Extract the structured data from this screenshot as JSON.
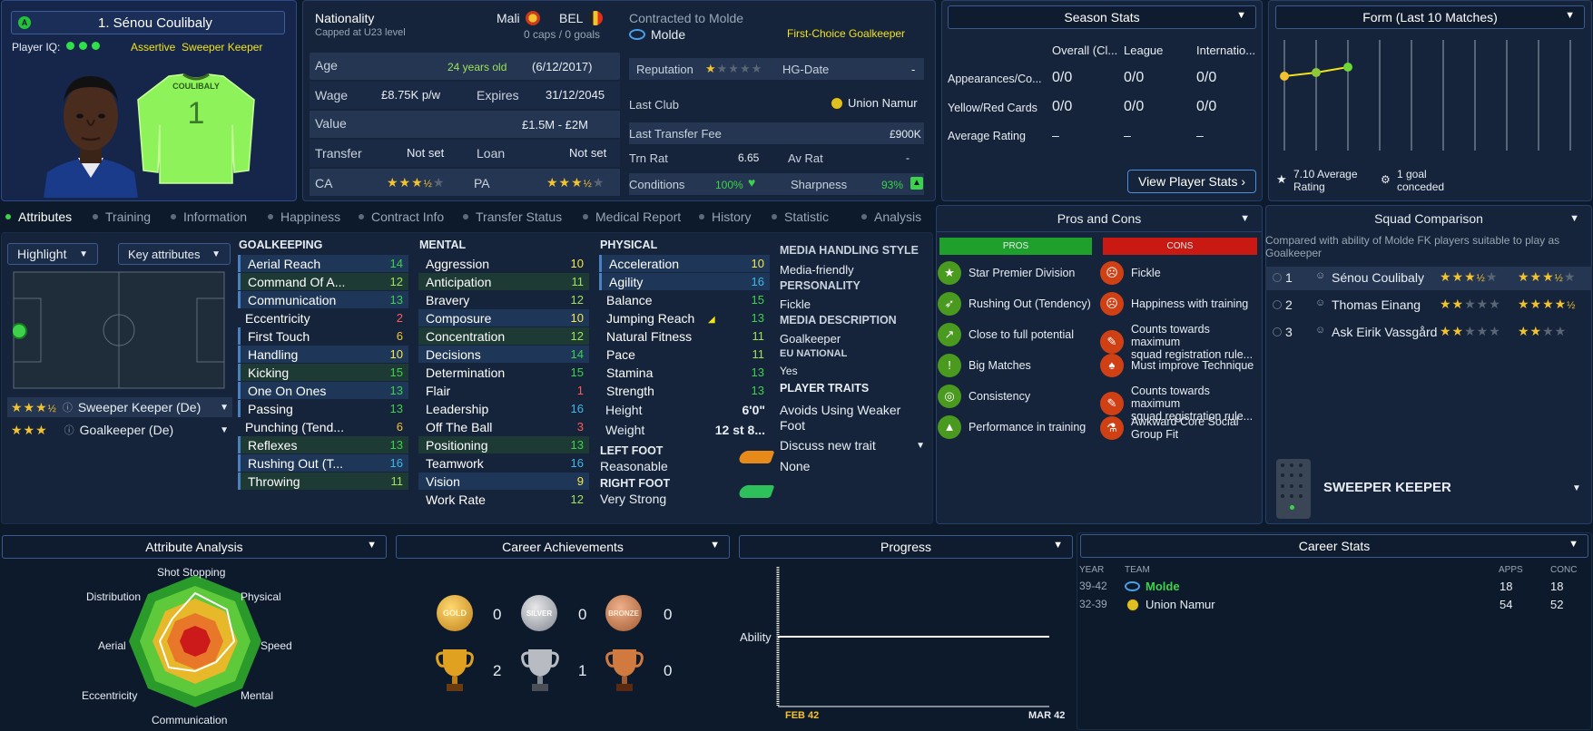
{
  "player": {
    "name": "1. Sénou Coulibaly",
    "iq_label": "Player IQ:",
    "role_prefix": "Assertive",
    "role_name": "Sweeper Keeper",
    "shirt_name": "COULIBALY",
    "shirt_number": "1"
  },
  "bio": {
    "nationality_label": "Nationality",
    "nationality_sub": "Capped at U23 level",
    "nation1": "Mali",
    "nation2": "BEL",
    "caps": "0 caps / 0 goals",
    "age_label": "Age",
    "age": "24 years old",
    "dob": "(6/12/2017)",
    "wage_label": "Wage",
    "wage": "£8.75K p/w",
    "expires_label": "Expires",
    "expires": "31/12/2045",
    "value_label": "Value",
    "value": "£1.5M - £2M",
    "transfer_label": "Transfer",
    "transfer": "Not set",
    "loan_label": "Loan",
    "loan": "Not set",
    "ca_label": "CA",
    "pa_label": "PA",
    "ca_stars": "★★★",
    "ca_half": "½",
    "ca_grey": "★",
    "pa_stars": "★★★",
    "pa_half": "½",
    "pa_grey": "★"
  },
  "contract": {
    "contracted_label": "Contracted to Molde",
    "club": "Molde",
    "status": "First-Choice Goalkeeper",
    "reputation_label": "Reputation",
    "rep_stars": "★",
    "rep_grey": "★★★★",
    "hg_label": "HG-Date",
    "hg_value": "-",
    "last_club_label": "Last Club",
    "last_club": "Union Namur",
    "last_fee_label": "Last Transfer Fee",
    "last_fee": "£900K",
    "trn_label": "Trn Rat",
    "trn_value": "6.65",
    "av_label": "Av Rat",
    "av_value": "-",
    "conditions_label": "Conditions",
    "conditions_value": "100%",
    "sharpness_label": "Sharpness",
    "sharpness_value": "93%"
  },
  "season": {
    "title": "Season Stats",
    "cols": [
      "Overall (Cl...",
      "League",
      "Internatio..."
    ],
    "rows": [
      {
        "label": "Appearances/Co...",
        "v": [
          "0/0",
          "0/0",
          "0/0"
        ]
      },
      {
        "label": "Yellow/Red Cards",
        "v": [
          "0/0",
          "0/0",
          "0/0"
        ]
      },
      {
        "label": "Average Rating",
        "v": [
          "–",
          "–",
          "–"
        ]
      }
    ],
    "button": "View Player Stats"
  },
  "form": {
    "title": "Form (Last 10 Matches)",
    "avg_value": "7.10",
    "avg_label": "Average",
    "avg_label2": "Rating",
    "goal_label": "1 goal",
    "goal_label2": "conceded"
  },
  "tabs": [
    "Attributes",
    "Training",
    "Information",
    "Happiness",
    "Contract Info",
    "Transfer Status",
    "Medical Report",
    "History",
    "Statistic",
    "Analysis"
  ],
  "controls": {
    "highlight": "Highlight",
    "key_attributes": "Key attributes"
  },
  "roles": [
    {
      "stars": "★★★",
      "half": "½",
      "name": "Sweeper Keeper (De)"
    },
    {
      "stars": "★★★",
      "half": "",
      "name": "Goalkeeper (De)"
    }
  ],
  "goalkeeping": {
    "title": "GOALKEEPING",
    "items": [
      {
        "n": "Aerial Reach",
        "v": "14"
      },
      {
        "n": "Command Of A...",
        "v": "12"
      },
      {
        "n": "Communication",
        "v": "13"
      },
      {
        "n": "Eccentricity",
        "v": "2"
      },
      {
        "n": "First Touch",
        "v": "6"
      },
      {
        "n": "Handling",
        "v": "10"
      },
      {
        "n": "Kicking",
        "v": "15"
      },
      {
        "n": "One On Ones",
        "v": "13"
      },
      {
        "n": "Passing",
        "v": "13"
      },
      {
        "n": "Punching (Tend...",
        "v": "6"
      },
      {
        "n": "Reflexes",
        "v": "13"
      },
      {
        "n": "Rushing Out (T...",
        "v": "16"
      },
      {
        "n": "Throwing",
        "v": "11"
      }
    ]
  },
  "mental": {
    "title": "MENTAL",
    "items": [
      {
        "n": "Aggression",
        "v": "10"
      },
      {
        "n": "Anticipation",
        "v": "11"
      },
      {
        "n": "Bravery",
        "v": "12"
      },
      {
        "n": "Composure",
        "v": "10"
      },
      {
        "n": "Concentration",
        "v": "12"
      },
      {
        "n": "Decisions",
        "v": "14"
      },
      {
        "n": "Determination",
        "v": "15"
      },
      {
        "n": "Flair",
        "v": "1"
      },
      {
        "n": "Leadership",
        "v": "16"
      },
      {
        "n": "Off The Ball",
        "v": "3"
      },
      {
        "n": "Positioning",
        "v": "13"
      },
      {
        "n": "Teamwork",
        "v": "16"
      },
      {
        "n": "Vision",
        "v": "9"
      },
      {
        "n": "Work Rate",
        "v": "12"
      }
    ]
  },
  "physical": {
    "title": "PHYSICAL",
    "items": [
      {
        "n": "Acceleration",
        "v": "10"
      },
      {
        "n": "Agility",
        "v": "16"
      },
      {
        "n": "Balance",
        "v": "15"
      },
      {
        "n": "Jumping Reach",
        "v": "13"
      },
      {
        "n": "Natural Fitness",
        "v": "11"
      },
      {
        "n": "Pace",
        "v": "11"
      },
      {
        "n": "Stamina",
        "v": "13"
      },
      {
        "n": "Strength",
        "v": "13"
      }
    ],
    "height_label": "Height",
    "height": "6'0\"",
    "weight_label": "Weight",
    "weight": "12 st 8...",
    "left_foot_label": "LEFT FOOT",
    "left_foot": "Reasonable",
    "right_foot_label": "RIGHT FOOT",
    "right_foot": "Very Strong"
  },
  "media": {
    "style_title": "MEDIA HANDLING STYLE",
    "style": "Media-friendly",
    "personality_title": "PERSONALITY",
    "personality": "Fickle",
    "desc_title": "MEDIA DESCRIPTION",
    "desc": "Goalkeeper",
    "eu_title": "EU NATIONAL",
    "eu": "Yes",
    "traits_title": "PLAYER TRAITS",
    "trait1": "Avoids Using Weaker",
    "trait1b": "Foot",
    "discuss": "Discuss new trait",
    "none": "None"
  },
  "proscons": {
    "title": "Pros and Cons",
    "pros_label": "PROS",
    "cons_label": "CONS",
    "pros": [
      "Star Premier Division",
      "Rushing Out (Tendency)",
      "Close to full potential",
      "Big Matches",
      "Consistency",
      "Performance in training"
    ],
    "cons": [
      {
        "a": "Fickle",
        "b": ""
      },
      {
        "a": "Happiness with training",
        "b": ""
      },
      {
        "a": "Counts towards maximum",
        "b": "squad registration rule..."
      },
      {
        "a": "Must improve Technique",
        "b": ""
      },
      {
        "a": "Counts towards maximum",
        "b": "squad registration rule..."
      },
      {
        "a": "Awkward Core Social",
        "b": "Group Fit"
      }
    ]
  },
  "squad": {
    "title": "Squad Comparison",
    "desc": "Compared with ability of Molde FK players suitable to play as Goalkeeper",
    "rows": [
      {
        "rank": "1",
        "name": "Sénou Coulibaly",
        "s1": "★★★",
        "s1h": "½",
        "s1g": "★",
        "s2": "★★★",
        "s2h": "½",
        "s2g": "★"
      },
      {
        "rank": "2",
        "name": "Thomas Einang",
        "s1": "★★",
        "s1h": "",
        "s1g": "★★★",
        "s2": "★★★★",
        "s2h": "½",
        "s2g": ""
      },
      {
        "rank": "3",
        "name": "Ask Eirik Vassgård",
        "s1": "★★",
        "s1h": "",
        "s1g": "★★★",
        "s2": "★★",
        "s2h": "",
        "s2g": "★★"
      }
    ],
    "role_title": "SWEEPER KEEPER"
  },
  "attr_analysis": {
    "title": "Attribute Analysis",
    "labels": [
      "Shot Stopping",
      "Physical",
      "Speed",
      "Mental",
      "Communication",
      "Eccentricity",
      "Aerial",
      "Distribution"
    ]
  },
  "achievements": {
    "title": "Career Achievements",
    "gold_label": "GOLD",
    "silver_label": "SILVER",
    "bronze_label": "BRONZE",
    "gold": "0",
    "silver": "0",
    "bronze": "0",
    "trophy1": "2",
    "trophy2": "1",
    "trophy3": "0"
  },
  "progress": {
    "title": "Progress",
    "ylabel": "Ability",
    "x_start": "FEB 42",
    "x_end": "MAR 42"
  },
  "career": {
    "title": "Career Stats",
    "col_year": "YEAR",
    "col_team": "TEAM",
    "col_apps": "APPS",
    "col_conc": "CONC",
    "rows": [
      {
        "year": "39-42",
        "team": "Molde",
        "apps": "18",
        "conc": "18"
      },
      {
        "year": "32-39",
        "team": "Union Namur",
        "apps": "54",
        "conc": "52"
      }
    ]
  },
  "colors": {
    "accent": "#3ed24c",
    "pro": "#1fa02c",
    "con": "#c81a12",
    "panel": "#15243a",
    "yellow": "#f2e21a"
  }
}
